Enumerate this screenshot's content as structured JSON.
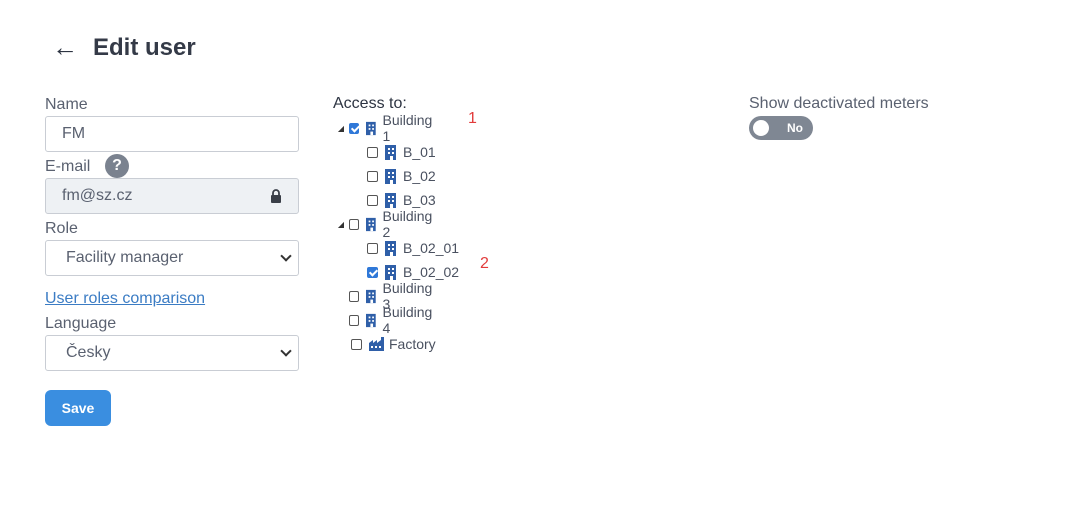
{
  "header": {
    "back_icon": "←",
    "title": "Edit user"
  },
  "form": {
    "name_label": "Name",
    "name_value": "FM",
    "email_label": "E-mail",
    "email_help_icon": "?",
    "email_value": "fm@sz.cz",
    "role_label": "Role",
    "role_value": "Facility manager",
    "roles_link": "User roles comparison",
    "language_label": "Language",
    "language_value": "Česky",
    "save_label": "Save"
  },
  "access": {
    "title": "Access to:",
    "nodes": [
      {
        "label": "Building 1",
        "checked": true,
        "expanded": true,
        "icon": "building-icon"
      },
      {
        "label": "B_01",
        "checked": false,
        "icon": "building-icon"
      },
      {
        "label": "B_02",
        "checked": false,
        "icon": "building-icon"
      },
      {
        "label": "B_03",
        "checked": false,
        "icon": "building-icon"
      },
      {
        "label": "Building 2",
        "checked": false,
        "expanded": true,
        "icon": "building-icon"
      },
      {
        "label": "B_02_01",
        "checked": false,
        "icon": "building-icon"
      },
      {
        "label": "B_02_02",
        "checked": true,
        "icon": "building-icon"
      },
      {
        "label": "Building 3",
        "checked": false,
        "icon": "building-icon"
      },
      {
        "label": "Building 4",
        "checked": false,
        "icon": "building-icon"
      },
      {
        "label": "Factory",
        "checked": false,
        "icon": "factory-icon"
      }
    ],
    "annotations": [
      "1",
      "2"
    ]
  },
  "settings": {
    "show_deactivated_label": "Show deactivated meters",
    "toggle_value": "No"
  },
  "colors": {
    "primary": "#3a8ee0",
    "link": "#3b7cc4",
    "annotation": "#e23b3b"
  }
}
